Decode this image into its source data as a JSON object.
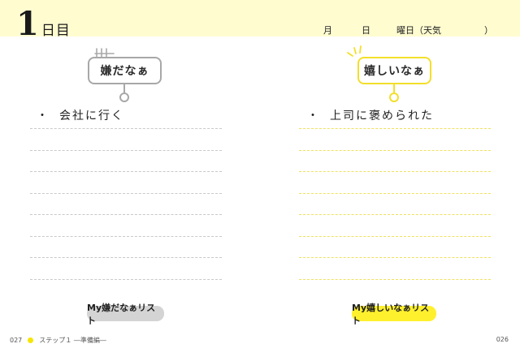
{
  "header": {
    "day_number": "1",
    "day_suffix": "日目",
    "month_label": "月",
    "day_label": "日",
    "weekday_label": "曜日（天気",
    "close_paren": "）"
  },
  "dislike": {
    "card_title": "嫌だなぁ",
    "bullet": "・",
    "item": "会社に行く",
    "list_label": "My嫌だなぁリスト"
  },
  "like": {
    "card_title": "嬉しいなぁ",
    "bullet": "・",
    "item": "上司に褒められた",
    "list_label": "My嬉しいなぁリスト"
  },
  "footer": {
    "page_left": "027",
    "section": "ステップ１ ―準備編―",
    "page_right": "026"
  },
  "colors": {
    "accent_yellow": "#fff02e",
    "band_yellow": "#fffcd0",
    "dislike_gray": "#a8a8a8"
  }
}
